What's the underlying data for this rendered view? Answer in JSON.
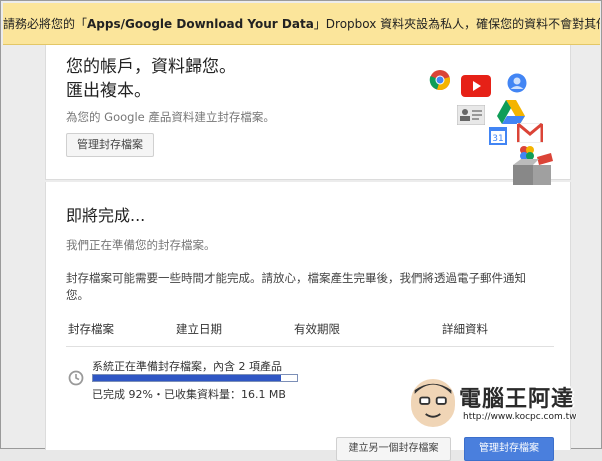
{
  "banner": {
    "before": "請務必將您的「",
    "folder": "Apps/Google Download Your Data",
    "after": "」Dropbox 資料夾設為私人，確保您的資料不會對其他人公開。"
  },
  "hero": {
    "title_line1": "您的帳戶，資料歸您。",
    "title_line2": "匯出複本。",
    "subtitle": "為您的 Google 產品資料建立封存檔案。",
    "manage_button": "管理封存檔案"
  },
  "status": {
    "title": "即將完成...",
    "preparing": "我們正在準備您的封存檔案。",
    "note": "封存檔案可能需要一些時間才能完成。請放心，檔案產生完畢後，我們將透過電子郵件通知您。"
  },
  "table": {
    "headers": [
      "封存檔案",
      "建立日期",
      "有效期限",
      "詳細資料"
    ],
    "row": {
      "status": "系統正在準備封存檔案，內含 2 項產品",
      "progress_percent": 92,
      "detail": "已完成 92%・已收集資料量：16.1 MB"
    }
  },
  "actions": {
    "create_another": "建立另一個封存檔案",
    "manage": "管理封存檔案"
  },
  "watermark": {
    "title": "電腦王阿達",
    "url": "http://www.kocpc.com.tw"
  },
  "colors": {
    "banner_bg": "#fbe59b",
    "progress_fill": "#2f56c4",
    "primary_button": "#4a7fdd"
  }
}
